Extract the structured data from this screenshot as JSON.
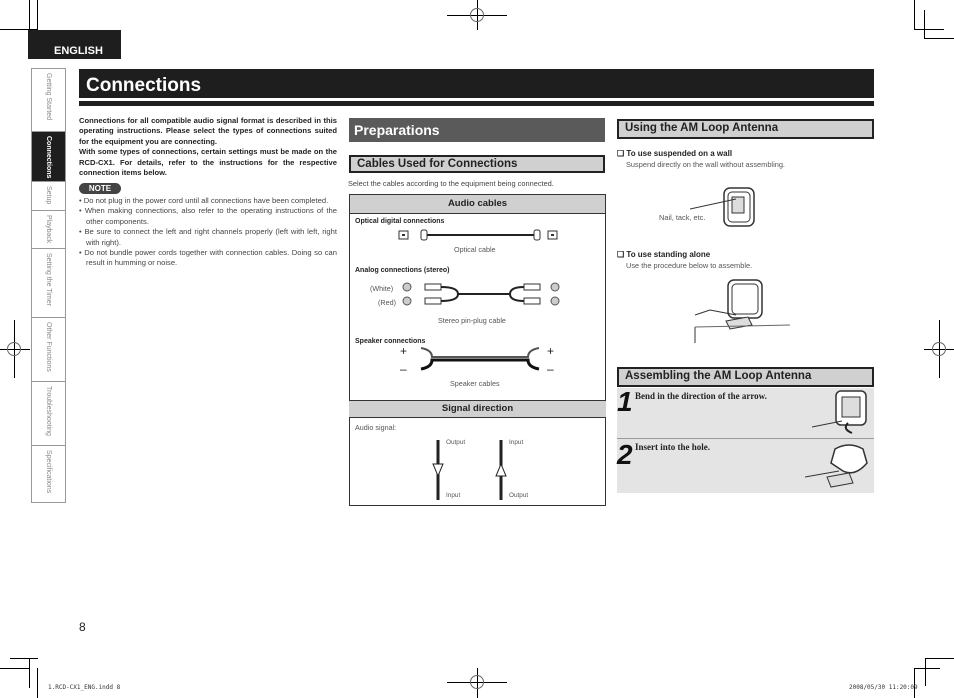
{
  "language_tab": "ENGLISH",
  "side_nav": [
    {
      "label": "Getting Started",
      "active": false
    },
    {
      "label": "Connections",
      "active": true
    },
    {
      "label": "Setup",
      "active": false
    },
    {
      "label": "Playback",
      "active": false
    },
    {
      "label": "Setting the Timer",
      "active": false
    },
    {
      "label": "Other Functions",
      "active": false
    },
    {
      "label": "Troubleshooting",
      "active": false
    },
    {
      "label": "Specifications",
      "active": false
    }
  ],
  "page_title": "Connections",
  "intro": {
    "paragraph1": "Connections for all compatible audio signal format is described in this operating instructions. Please select the types of connections suited for the equipment you are connecting.",
    "paragraph2": "With some types of connections, certain settings must be made on the RCD-CX1. For details, refer to the instructions for the respective connection items below."
  },
  "note": {
    "label": "NOTE",
    "items": [
      "Do not plug in the power cord until all connections have been completed.",
      "When making connections, also refer to the operating instructions of the other components.",
      "Be sure to connect the left and right channels properly (left with left, right with right).",
      "Do not bundle power cords together with connection cables. Doing so can result in humming or noise."
    ]
  },
  "preparations": {
    "heading": "Preparations",
    "cables_heading": "Cables Used for Connections",
    "cables_desc": "Select the cables according to the equipment being connected.",
    "audio_cables": {
      "heading": "Audio cables",
      "optical": {
        "label": "Optical digital connections",
        "caption": "Optical cable"
      },
      "analog": {
        "label": "Analog connections (stereo)",
        "white": "(White)",
        "red": "(Red)",
        "caption": "Stereo pin-plug cable"
      },
      "speaker": {
        "label": "Speaker connections",
        "plus": "+",
        "minus": "–",
        "caption": "Speaker cables"
      }
    },
    "signal_direction": {
      "heading": "Signal direction",
      "audio_signal": "Audio signal:",
      "left": {
        "top": "Output",
        "bottom": "Input"
      },
      "right": {
        "top": "Input",
        "bottom": "Output"
      }
    }
  },
  "am_antenna": {
    "using_heading": "Using the AM Loop Antenna",
    "wall": {
      "title": "❑ To use suspended on a wall",
      "desc": "Suspend directly on the wall without assembling.",
      "callout": "Nail, tack, etc."
    },
    "standing": {
      "title": "❑ To use standing alone",
      "desc": "Use the procedure below to assemble."
    },
    "assembling_heading": "Assembling the AM Loop Antenna",
    "steps": [
      {
        "num": "1",
        "text": "Bend in the direction of the arrow."
      },
      {
        "num": "2",
        "text": "Insert into the hole."
      }
    ]
  },
  "page_number": "8",
  "slug_left": "1.RCD-CX1_ENG.indd   8",
  "slug_right": "2008/05/30   11:20:09"
}
